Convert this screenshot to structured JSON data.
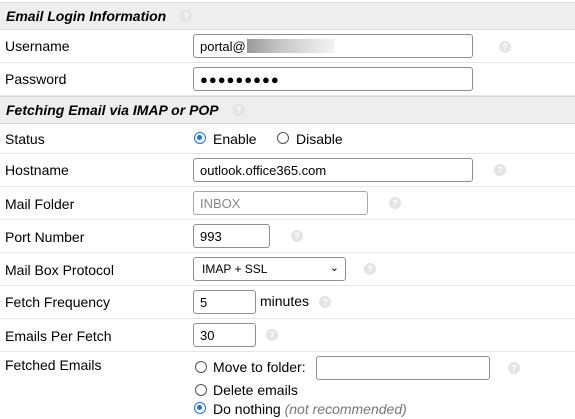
{
  "sections": {
    "login": {
      "title": "Email Login Information"
    },
    "fetching": {
      "title": "Fetching Email via IMAP or POP"
    }
  },
  "help_symbol": "?",
  "fields": {
    "username": {
      "label": "Username",
      "value": "portal@"
    },
    "password": {
      "label": "Password",
      "value": "●●●●●●●●●"
    },
    "status": {
      "label": "Status",
      "options": [
        "Enable",
        "Disable"
      ],
      "selected": "Enable"
    },
    "hostname": {
      "label": "Hostname",
      "value": "outlook.office365.com"
    },
    "mail_folder": {
      "label": "Mail Folder",
      "placeholder": "INBOX"
    },
    "port_number": {
      "label": "Port Number",
      "value": "993"
    },
    "protocol": {
      "label": "Mail Box Protocol",
      "selected": "IMAP + SSL"
    },
    "fetch_frequency": {
      "label": "Fetch Frequency",
      "value": "5",
      "unit": "minutes"
    },
    "emails_per_fetch": {
      "label": "Emails Per Fetch",
      "value": "30"
    },
    "fetched_emails": {
      "label": "Fetched Emails",
      "options": {
        "move": "Move to folder:",
        "delete": "Delete emails",
        "nothing": "Do nothing",
        "nothing_note": "(not recommended)"
      },
      "selected": "Do nothing"
    }
  },
  "colors": {
    "accent": "#1a73e8",
    "header_bg": "#eeeeee"
  }
}
